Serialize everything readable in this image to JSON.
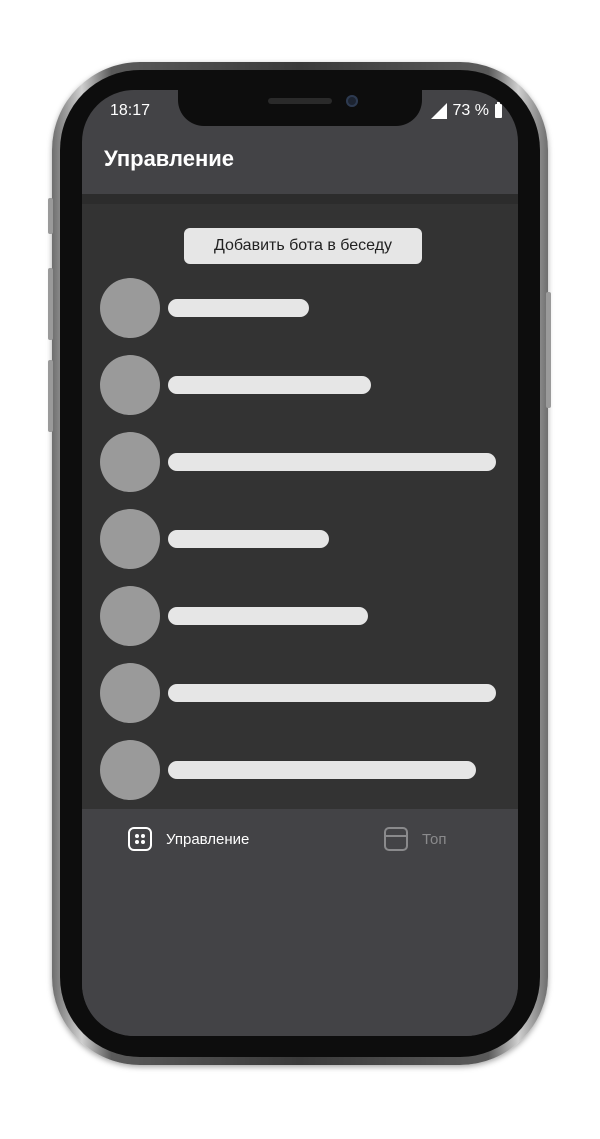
{
  "status_bar": {
    "time": "18:17",
    "battery": "73 %"
  },
  "header": {
    "title": "Управление"
  },
  "actions": {
    "add_bot_label": "Добавить бота в беседу"
  },
  "list": {
    "items": [
      {
        "bar_fraction": 0.43
      },
      {
        "bar_fraction": 0.62
      },
      {
        "bar_fraction": 1.0
      },
      {
        "bar_fraction": 0.49
      },
      {
        "bar_fraction": 0.61
      },
      {
        "bar_fraction": 1.0
      },
      {
        "bar_fraction": 0.94
      }
    ]
  },
  "tabbar": {
    "tabs": [
      {
        "label": "Управление",
        "icon": "grid-dots-icon",
        "active": true
      },
      {
        "label": "Топ",
        "icon": "window-icon",
        "active": false
      }
    ]
  }
}
